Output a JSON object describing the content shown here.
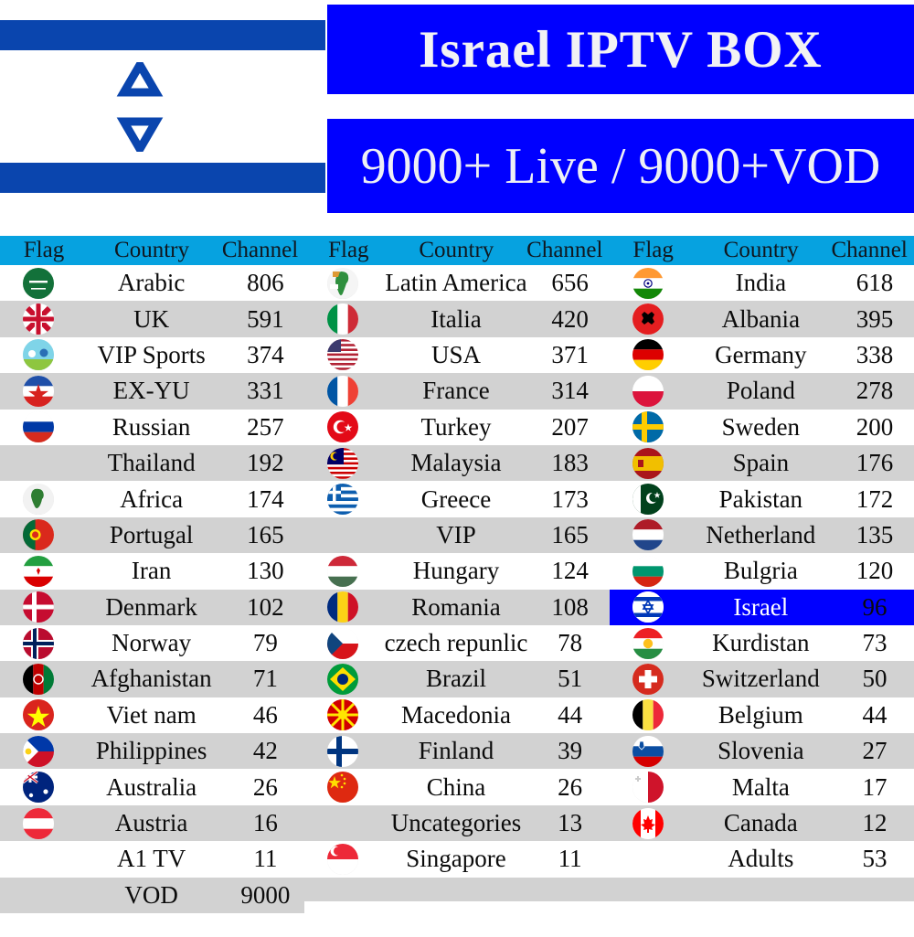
{
  "banner": {
    "flag_icon": "israel-flag",
    "title": "Israel IPTV BOX",
    "subtitle": "9000+ Live / 9000+VOD",
    "title_bg": "#0000FF",
    "title_color": "#F2F2F4"
  },
  "table": {
    "header_bg": "#06A2E0",
    "row_alt_bg": "#D2D2D2",
    "highlight_bg": "#0000FF",
    "headers": {
      "flag": "Flag",
      "country": "Country",
      "channel": "Channel"
    },
    "columns": [
      {
        "rows": [
          {
            "flag": "saudi-arabia-flag",
            "country": "Arabic",
            "channel": "806"
          },
          {
            "flag": "uk-flag",
            "country": "UK",
            "channel": "591"
          },
          {
            "flag": "vip-sports-icon",
            "country": "VIP Sports",
            "channel": "374"
          },
          {
            "flag": "ex-yu-flag",
            "country": "EX-YU",
            "channel": "331"
          },
          {
            "flag": "russia-flag",
            "country": "Russian",
            "channel": "257"
          },
          {
            "flag": "none",
            "country": "Thailand",
            "channel": "192"
          },
          {
            "flag": "africa-icon",
            "country": "Africa",
            "channel": "174"
          },
          {
            "flag": "portugal-flag",
            "country": "Portugal",
            "channel": "165"
          },
          {
            "flag": "iran-flag",
            "country": "Iran",
            "channel": "130"
          },
          {
            "flag": "denmark-flag",
            "country": "Denmark",
            "channel": "102"
          },
          {
            "flag": "norway-flag",
            "country": "Norway",
            "channel": "79"
          },
          {
            "flag": "afghanistan-flag",
            "country": "Afghanistan",
            "channel": "71"
          },
          {
            "flag": "vietnam-flag",
            "country": "Viet nam",
            "channel": "46"
          },
          {
            "flag": "philippines-flag",
            "country": "Philippines",
            "channel": "42"
          },
          {
            "flag": "australia-flag",
            "country": "Australia",
            "channel": "26"
          },
          {
            "flag": "austria-flag",
            "country": "Austria",
            "channel": "16"
          },
          {
            "flag": "none",
            "country": "A1 TV",
            "channel": "11"
          },
          {
            "flag": "none",
            "country": "VOD",
            "channel": "9000"
          }
        ]
      },
      {
        "rows": [
          {
            "flag": "latin-america-icon",
            "country": "Latin America",
            "channel": "656"
          },
          {
            "flag": "italy-flag",
            "country": "Italia",
            "channel": "420"
          },
          {
            "flag": "usa-flag",
            "country": "USA",
            "channel": "371"
          },
          {
            "flag": "france-flag",
            "country": "France",
            "channel": "314"
          },
          {
            "flag": "turkey-flag",
            "country": "Turkey",
            "channel": "207"
          },
          {
            "flag": "malaysia-flag",
            "country": "Malaysia",
            "channel": "183"
          },
          {
            "flag": "greece-flag",
            "country": "Greece",
            "channel": "173"
          },
          {
            "flag": "none",
            "country": "VIP",
            "channel": "165"
          },
          {
            "flag": "hungary-flag",
            "country": "Hungary",
            "channel": "124"
          },
          {
            "flag": "romania-flag",
            "country": "Romania",
            "channel": "108"
          },
          {
            "flag": "czech-flag",
            "country": "czech repunlic",
            "channel": "78"
          },
          {
            "flag": "brazil-flag",
            "country": "Brazil",
            "channel": "51"
          },
          {
            "flag": "macedonia-flag",
            "country": "Macedonia",
            "channel": "44"
          },
          {
            "flag": "finland-flag",
            "country": "Finland",
            "channel": "39"
          },
          {
            "flag": "china-flag",
            "country": "China",
            "channel": "26"
          },
          {
            "flag": "none",
            "country": "Uncategories",
            "channel": "13"
          },
          {
            "flag": "singapore-flag",
            "country": "Singapore",
            "channel": "11"
          }
        ]
      },
      {
        "rows": [
          {
            "flag": "india-flag",
            "country": "India",
            "channel": "618"
          },
          {
            "flag": "albania-flag",
            "country": "Albania",
            "channel": "395"
          },
          {
            "flag": "germany-flag",
            "country": "Germany",
            "channel": "338"
          },
          {
            "flag": "poland-flag",
            "country": "Poland",
            "channel": "278"
          },
          {
            "flag": "sweden-flag",
            "country": "Sweden",
            "channel": "200"
          },
          {
            "flag": "spain-flag",
            "country": "Spain",
            "channel": "176"
          },
          {
            "flag": "pakistan-flag",
            "country": "Pakistan",
            "channel": "172"
          },
          {
            "flag": "netherlands-flag",
            "country": "Netherland",
            "channel": "135"
          },
          {
            "flag": "bulgaria-flag",
            "country": "Bulgria",
            "channel": "120"
          },
          {
            "flag": "israel-flag",
            "country": "Israel",
            "channel": "96",
            "highlight": true
          },
          {
            "flag": "kurdistan-flag",
            "country": "Kurdistan",
            "channel": "73"
          },
          {
            "flag": "switzerland-flag",
            "country": "Switzerland",
            "channel": "50"
          },
          {
            "flag": "belgium-flag",
            "country": "Belgium",
            "channel": "44"
          },
          {
            "flag": "slovenia-flag",
            "country": "Slovenia",
            "channel": "27"
          },
          {
            "flag": "malta-flag",
            "country": "Malta",
            "channel": "17"
          },
          {
            "flag": "canada-flag",
            "country": "Canada",
            "channel": "12"
          },
          {
            "flag": "none",
            "country": "Adults",
            "channel": "53"
          }
        ]
      }
    ]
  }
}
